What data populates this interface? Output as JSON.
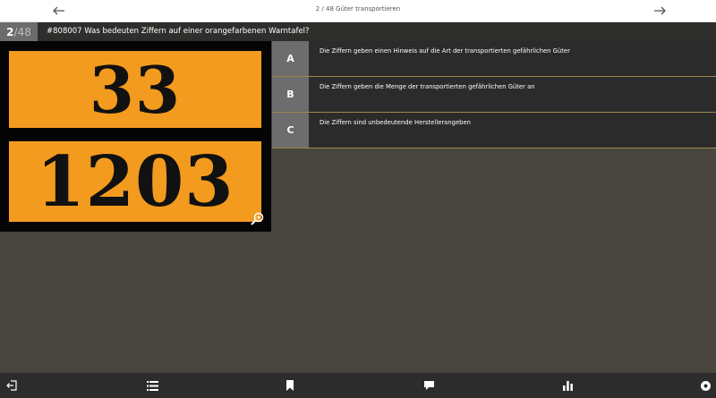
{
  "header": {
    "progress_title": "2 / 48 Güter transportieren"
  },
  "question": {
    "current": "2",
    "total": "/48",
    "text": "#808007 Was bedeuten Ziffern auf einer orangefarbenen Warntafel?"
  },
  "image": {
    "plate_top": "33",
    "plate_bottom": "1203",
    "plate_color": "#f39b1f"
  },
  "answers": [
    {
      "letter": "A",
      "text": "Die Ziffern geben einen Hinweis auf die Art der transportierten gefährlichen Güter"
    },
    {
      "letter": "B",
      "text": "Die Ziffern geben die Menge der transportierten gefährlichen Güter an"
    },
    {
      "letter": "C",
      "text": "Die Ziffern sind unbedeutende Herstellerangeben"
    }
  ],
  "bottom_nav": [
    "exit-icon",
    "list-icon",
    "bookmark-icon",
    "comment-icon",
    "stats-icon",
    "settings-icon"
  ]
}
